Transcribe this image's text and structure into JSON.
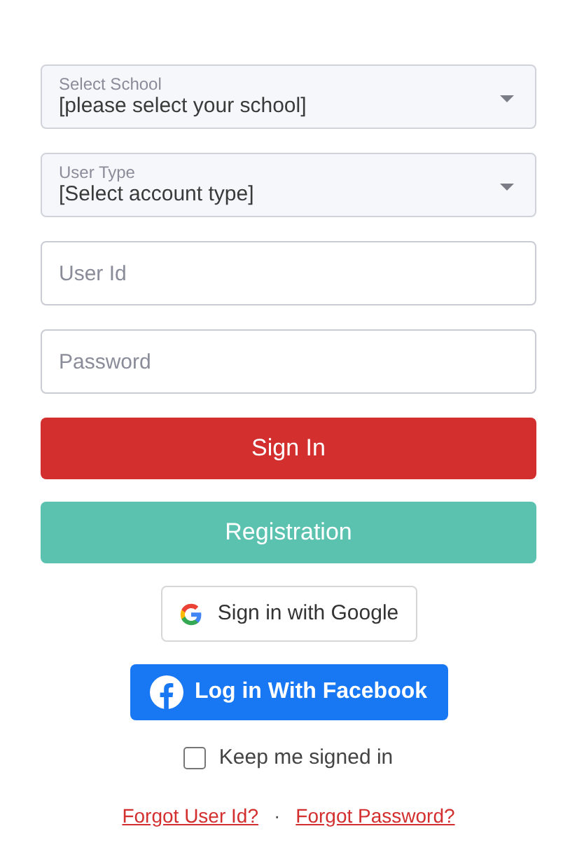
{
  "selects": [
    {
      "label": "Select School",
      "value": "[please select your school]"
    },
    {
      "label": "User Type",
      "value": "[Select account type]"
    }
  ],
  "inputs": [
    {
      "placeholder": "User Id"
    },
    {
      "placeholder": "Password"
    }
  ],
  "buttons": [
    {
      "kind": "primary",
      "label": "Sign In"
    },
    {
      "kind": "secondary",
      "label": "Registration"
    }
  ],
  "google_button": "Sign in with Google",
  "facebook_button": "Log in With Facebook",
  "keep_signed_in": {
    "label": "Keep me signed in",
    "checked": false
  },
  "links": [
    "Forgot User Id?",
    "Forgot Password?"
  ],
  "link_separator": "·"
}
